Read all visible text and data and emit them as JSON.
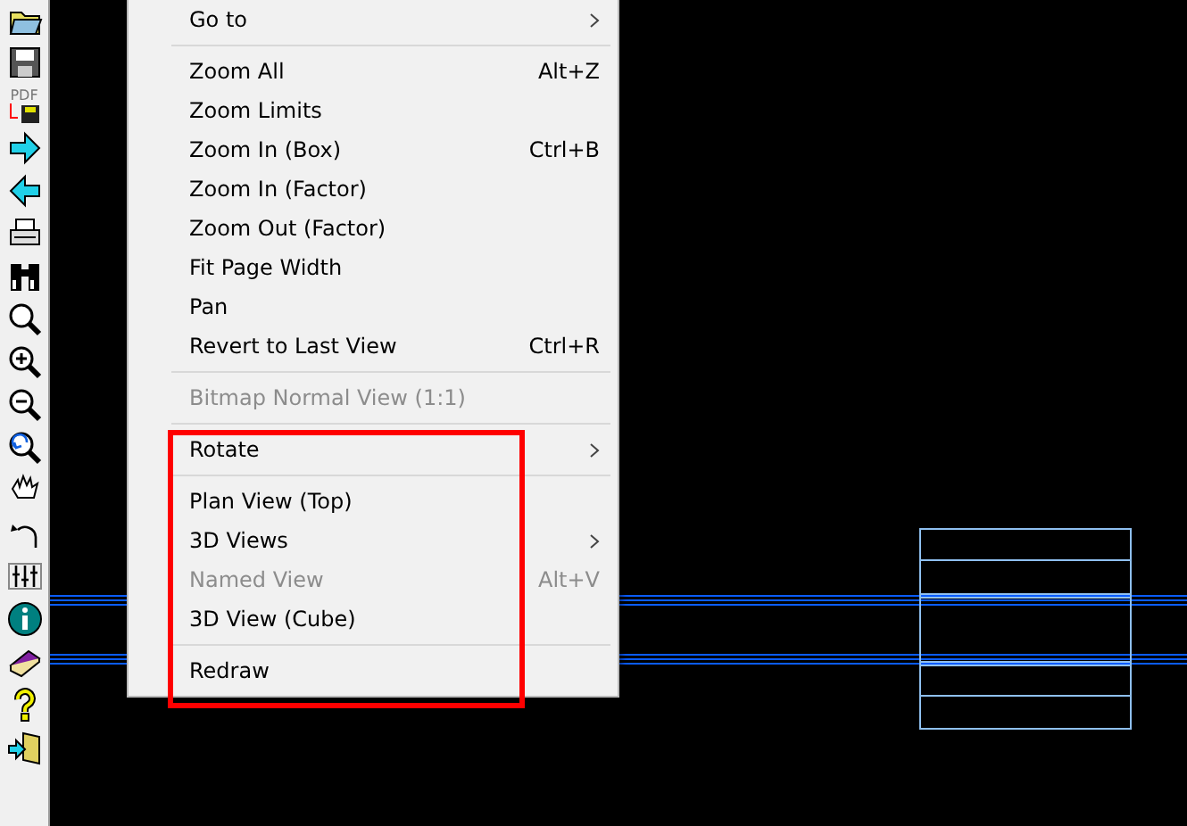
{
  "toolbar": {
    "buttons": [
      {
        "kind": "open"
      },
      {
        "kind": "save"
      },
      {
        "kind": "pdf",
        "label": "PDF"
      },
      {
        "kind": "forward"
      },
      {
        "kind": "back"
      },
      {
        "kind": "print"
      },
      {
        "kind": "binoculars"
      },
      {
        "kind": "zoom"
      },
      {
        "kind": "zoom-in"
      },
      {
        "kind": "zoom-out"
      },
      {
        "kind": "zoom-previous"
      },
      {
        "kind": "pan"
      },
      {
        "kind": "undo"
      },
      {
        "kind": "layers"
      },
      {
        "kind": "info"
      },
      {
        "kind": "book"
      },
      {
        "kind": "help"
      },
      {
        "kind": "exit"
      }
    ]
  },
  "context_menu": {
    "items": [
      {
        "kind": "item",
        "label": "Go to",
        "submenu": true,
        "disabled": false
      },
      {
        "kind": "separator"
      },
      {
        "kind": "item",
        "label": "Zoom All",
        "shortcut": "Alt+Z",
        "disabled": false
      },
      {
        "kind": "item",
        "label": "Zoom Limits",
        "disabled": false
      },
      {
        "kind": "item",
        "label": "Zoom In (Box)",
        "shortcut": "Ctrl+B",
        "disabled": false
      },
      {
        "kind": "item",
        "label": "Zoom In (Factor)",
        "disabled": false
      },
      {
        "kind": "item",
        "label": "Zoom Out (Factor)",
        "disabled": false
      },
      {
        "kind": "item",
        "label": "Fit Page Width",
        "disabled": false
      },
      {
        "kind": "item",
        "label": "Pan",
        "disabled": false
      },
      {
        "kind": "item",
        "label": "Revert to Last View",
        "shortcut": "Ctrl+R",
        "disabled": false
      },
      {
        "kind": "separator"
      },
      {
        "kind": "item",
        "label": "Bitmap Normal View (1:1)",
        "disabled": true
      },
      {
        "kind": "separator"
      },
      {
        "kind": "item",
        "label": "Rotate",
        "submenu": true,
        "disabled": false
      },
      {
        "kind": "separator"
      },
      {
        "kind": "item",
        "label": "Plan View (Top)",
        "disabled": false
      },
      {
        "kind": "item",
        "label": "3D Views",
        "submenu": true,
        "disabled": false
      },
      {
        "kind": "item",
        "label": "Named View",
        "shortcut": "Alt+V",
        "disabled": true
      },
      {
        "kind": "item",
        "label": "3D View (Cube)",
        "disabled": false
      },
      {
        "kind": "separator"
      },
      {
        "kind": "item",
        "label": "Redraw",
        "disabled": false
      }
    ]
  }
}
